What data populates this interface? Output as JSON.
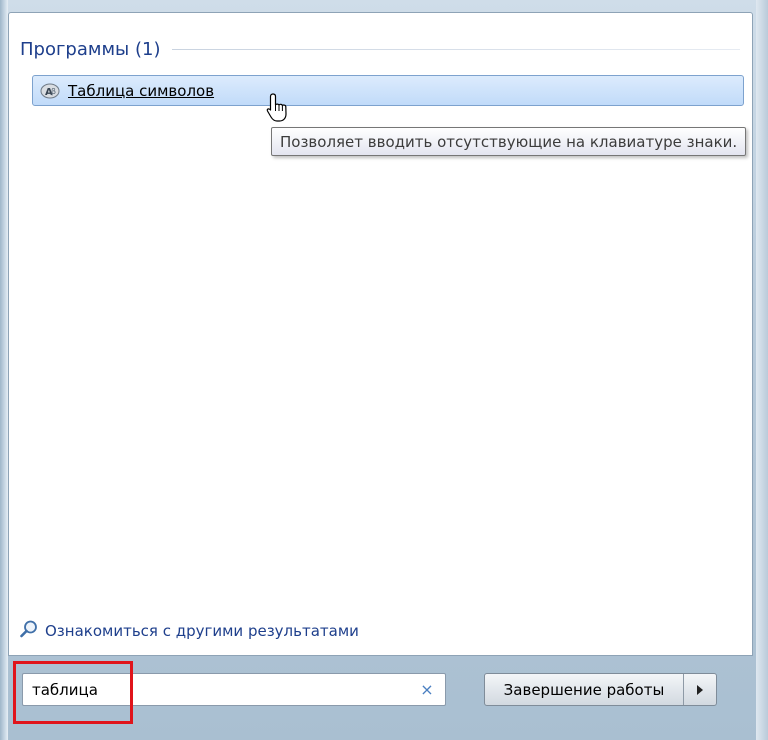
{
  "programs_group": {
    "title": "Программы (1)"
  },
  "results": [
    {
      "label": "Таблица символов",
      "icon": "character-map-icon"
    }
  ],
  "tooltip": {
    "text": "Позволяет вводить отсутствующие на клавиатуре знаки."
  },
  "more_results": {
    "label": "Ознакомиться с другими результатами",
    "icon": "search-magnifier-icon"
  },
  "search": {
    "value": "таблица",
    "clear_icon": "×"
  },
  "shutdown": {
    "label": "Завершение работы",
    "arrow_icon": "triangle-right-icon"
  },
  "colors": {
    "group_title": "#1e3f8c",
    "highlight_border": "#e0141b",
    "selection_fill": "#c1dbfa"
  }
}
